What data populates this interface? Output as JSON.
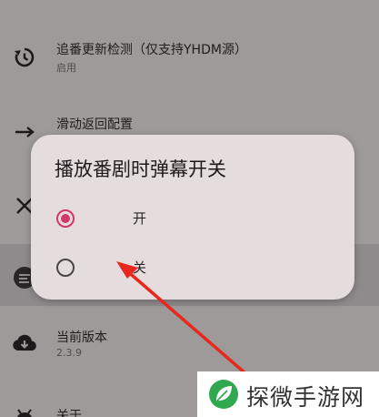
{
  "settings": {
    "items": [
      {
        "title": "追番更新检测（仅支持YHDM源）",
        "subtitle": "启用",
        "icon": "history-icon"
      },
      {
        "title": "滑动返回配置",
        "subtitle": "",
        "icon": "arrow-right-icon"
      },
      {
        "title": "",
        "subtitle": "",
        "icon": "close-icon"
      },
      {
        "title": "",
        "subtitle": "",
        "icon": "danmaku-icon"
      },
      {
        "title": "当前版本",
        "subtitle": "2.3.9",
        "icon": "cloud-download-icon"
      },
      {
        "title": "关于",
        "subtitle": "",
        "icon": "android-icon"
      }
    ]
  },
  "dialog": {
    "title": "播放番剧时弹幕开关",
    "options": [
      {
        "label": "开",
        "checked": true
      },
      {
        "label": "关",
        "checked": false
      }
    ]
  },
  "watermark": {
    "text": "探微手游网"
  },
  "colors": {
    "accent": "#d2386a",
    "dialog_bg": "#e5dcdd",
    "scrim": "#9e9a9a",
    "arrow": "#e8281e"
  }
}
